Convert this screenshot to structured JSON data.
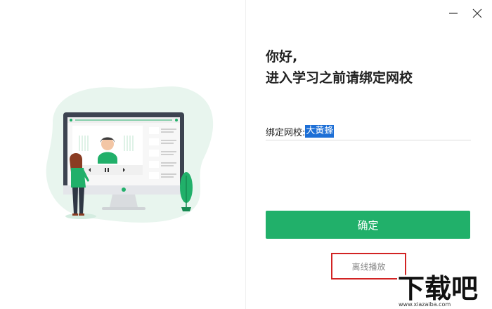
{
  "window": {
    "minimize_icon": "minimize-icon",
    "close_icon": "close-icon"
  },
  "greeting": {
    "line1": "你好,",
    "line2": "进入学习之前请绑定网校"
  },
  "school_field": {
    "label": "绑定网校:",
    "value": "大黄蜂"
  },
  "confirm_label": "确定",
  "offline_label": "离线播放",
  "watermark": {
    "logo_text": "下载吧",
    "url": "www.xiazaiba.com"
  },
  "colors": {
    "accent": "#21b06a",
    "highlight": "#1d6fd6",
    "annotation_border": "#d22323"
  }
}
